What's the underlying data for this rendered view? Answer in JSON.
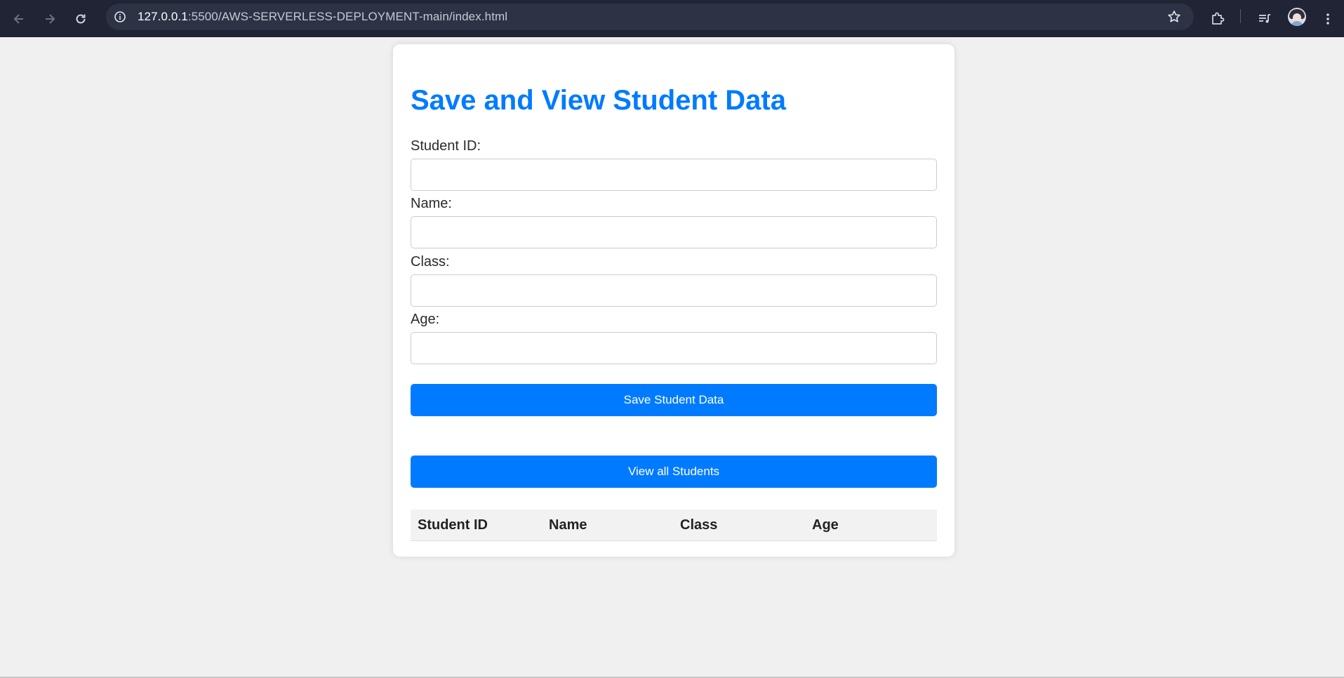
{
  "browser": {
    "url_host": "127.0.0.1",
    "url_path": ":5500/AWS-SERVERLESS-DEPLOYMENT-main/index.html",
    "icons": [
      "back-arrow-icon",
      "forward-arrow-icon",
      "reload-icon",
      "info-icon",
      "star-icon",
      "extensions-icon",
      "media-queue-icon",
      "profile-avatar",
      "more-vert-icon"
    ]
  },
  "page": {
    "title": "Save and View Student Data",
    "form": {
      "student_id_label": "Student ID:",
      "student_id_value": "",
      "name_label": "Name:",
      "name_value": "",
      "class_label": "Class:",
      "class_value": "",
      "age_label": "Age:",
      "age_value": ""
    },
    "save_button": "Save Student Data",
    "view_button": "View all Students",
    "table": {
      "headers": [
        "Student ID",
        "Name",
        "Class",
        "Age"
      ],
      "rows": []
    }
  },
  "colors": {
    "accent": "#007bff",
    "page_bg": "#f0f0f0",
    "chrome_bg": "#202435"
  }
}
